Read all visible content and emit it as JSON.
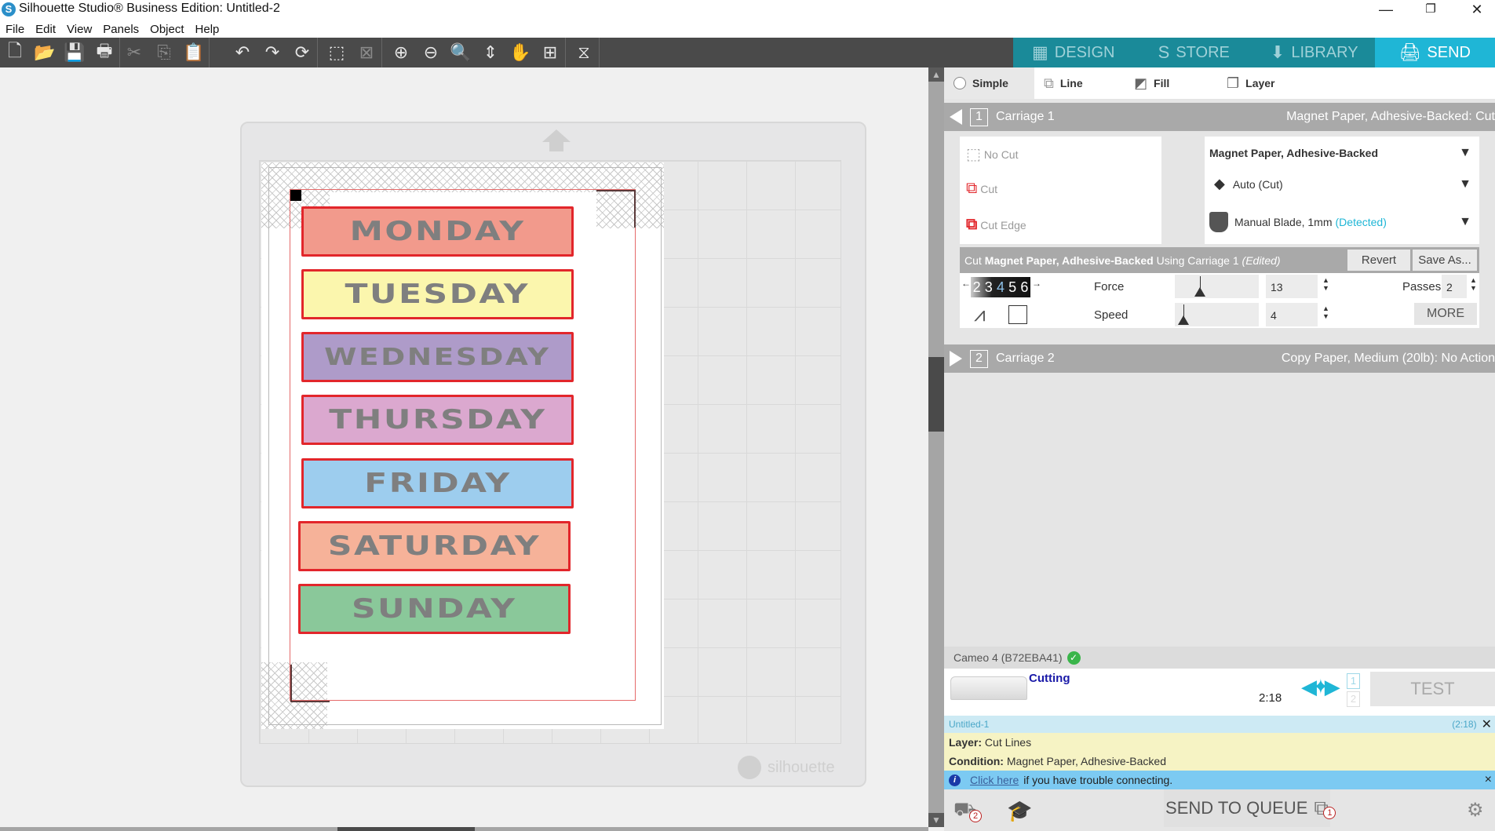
{
  "window": {
    "title": "Silhouette Studio® Business Edition: Untitled-2",
    "logo": "S",
    "minimize": "—",
    "restore": "❐",
    "close": "✕"
  },
  "menu": [
    "File",
    "Edit",
    "View",
    "Panels",
    "Object",
    "Help"
  ],
  "toolbar": {
    "groups": [
      [
        {
          "name": "new-document-icon",
          "glyph": "🗋"
        },
        {
          "name": "open-folder-icon",
          "glyph": "📂"
        },
        {
          "name": "save-icon",
          "glyph": "💾"
        },
        {
          "name": "print-icon",
          "glyph": "🖶"
        }
      ],
      [
        {
          "name": "cut-icon",
          "glyph": "✂"
        },
        {
          "name": "copy-icon",
          "glyph": "⎘"
        },
        {
          "name": "paste-icon",
          "glyph": "📋"
        }
      ],
      [
        {
          "name": "undo-icon",
          "glyph": "↶"
        },
        {
          "name": "redo-icon",
          "glyph": "↷"
        },
        {
          "name": "redraw-icon",
          "glyph": "⟳"
        }
      ],
      [
        {
          "name": "select-all-icon",
          "glyph": "⬚"
        },
        {
          "name": "deselect-icon",
          "glyph": "⊠"
        }
      ],
      [
        {
          "name": "zoom-in-icon",
          "glyph": "⊕"
        },
        {
          "name": "zoom-out-icon",
          "glyph": "⊖"
        },
        {
          "name": "zoom-select-icon",
          "glyph": "🔍"
        },
        {
          "name": "drag-zoom-icon",
          "glyph": "⇕"
        },
        {
          "name": "pan-hand-icon",
          "glyph": "✋"
        },
        {
          "name": "fit-to-page-icon",
          "glyph": "⊞"
        }
      ],
      [
        {
          "name": "stitch-icon",
          "glyph": "⧖"
        }
      ]
    ]
  },
  "mode_tabs": [
    {
      "label": "DESIGN",
      "icon": "▦",
      "active": false
    },
    {
      "label": "STORE",
      "icon": "S",
      "active": false
    },
    {
      "label": "LIBRARY",
      "icon": "⬇",
      "active": false
    },
    {
      "label": "SEND",
      "icon": "🖨",
      "active": true
    }
  ],
  "canvas": {
    "brand": "silhouette",
    "labels": [
      {
        "text": "MONDAY",
        "color": "#f29a8c"
      },
      {
        "text": "TUESDAY",
        "color": "#fbf6ad"
      },
      {
        "text": "WEDNESDAY",
        "color": "#ae9bc9"
      },
      {
        "text": "THURSDAY",
        "color": "#dba8cf"
      },
      {
        "text": "FRIDAY",
        "color": "#9dcdee"
      },
      {
        "text": "SATURDAY",
        "color": "#f6b299"
      },
      {
        "text": "SUNDAY",
        "color": "#8ac89a"
      }
    ],
    "text_color": "#7f7f7f",
    "cut_line_color": "#e2262b"
  },
  "send_panel": {
    "sub_tabs": [
      {
        "label": "Simple",
        "active": true
      },
      {
        "label": "Line",
        "active": false
      },
      {
        "label": "Fill",
        "active": false
      },
      {
        "label": "Layer",
        "active": false
      }
    ],
    "carriage1": {
      "number": "1",
      "label": "Carriage 1",
      "summary": "Magnet Paper, Adhesive-Backed: Cut",
      "actions": [
        {
          "label": "No Cut",
          "selected": false
        },
        {
          "label": "Cut",
          "selected": false
        },
        {
          "label": "Cut Edge",
          "selected": false
        }
      ],
      "material": "Magnet Paper, Adhesive-Backed",
      "action_mode": "Auto (Cut)",
      "tool": "Manual Blade, 1mm",
      "tool_status": "(Detected)",
      "condition": {
        "prefix": "Cut ",
        "material": "Magnet Paper, Adhesive-Backed",
        "middle": " Using Carriage 1 ",
        "suffix": "(Edited)",
        "revert": "Revert",
        "save_as": "Save As..."
      },
      "blade_depth": [
        "2",
        "3",
        "4",
        "5",
        "6"
      ],
      "blade_depth_value": "4",
      "force_label": "Force",
      "force": "13",
      "force_fraction": 0.3,
      "speed_label": "Speed",
      "speed": "4",
      "speed_fraction": 0.1,
      "passes_label": "Passes",
      "passes": "2",
      "more": "MORE"
    },
    "carriage2": {
      "number": "2",
      "label": "Carriage 2",
      "summary": "Copy Paper, Medium (20lb): No Action"
    },
    "device": {
      "name": "Cameo 4 (B72EBA41)",
      "status": "Cutting",
      "time": "2:18",
      "queue_slots": [
        "1",
        "2"
      ],
      "test": "TEST"
    },
    "job": {
      "name": "Untitled-1",
      "time": "(2:18)",
      "layer_label": "Layer:",
      "layer": "Cut Lines",
      "condition_label": "Condition:",
      "condition": "Magnet Paper, Adhesive-Backed"
    },
    "info": {
      "link": "Click here",
      "text": "if you have trouble connecting.",
      "close": "×"
    },
    "bottom": {
      "machines_badge": "2",
      "send_to_queue": "SEND TO QUEUE",
      "queue_badge": "1"
    }
  }
}
